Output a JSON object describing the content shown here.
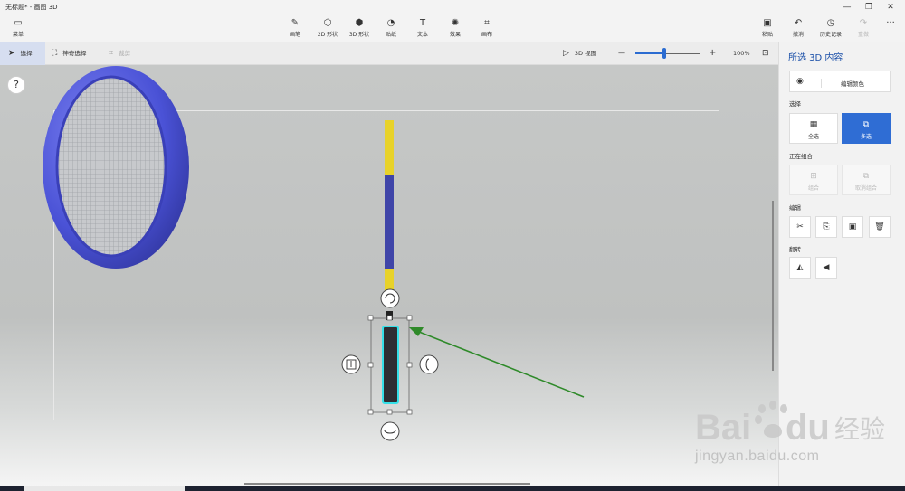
{
  "window": {
    "title": "无标题* - 画图 3D",
    "minimize": "—",
    "restore": "❐",
    "close": "✕"
  },
  "topbar": {
    "menu": {
      "label": "菜单",
      "icon": "folder-icon"
    },
    "tools": [
      {
        "label": "画笔",
        "icon": "brush-icon"
      },
      {
        "label": "2D 形状",
        "icon": "2d-shapes-icon"
      },
      {
        "label": "3D 形状",
        "icon": "3d-shapes-icon"
      },
      {
        "label": "贴纸",
        "icon": "sticker-icon"
      },
      {
        "label": "文本",
        "icon": "text-icon"
      },
      {
        "label": "效果",
        "icon": "effects-icon"
      },
      {
        "label": "画布",
        "icon": "canvas-icon"
      }
    ],
    "right": [
      {
        "label": "粘贴",
        "icon": "paste-icon"
      },
      {
        "label": "撤消",
        "icon": "undo-icon"
      },
      {
        "label": "历史记录",
        "icon": "history-icon"
      },
      {
        "label": "重做",
        "icon": "redo-icon"
      }
    ],
    "more": "···"
  },
  "toolbar": {
    "select": "选择",
    "magic_select": "神奇选择",
    "crop": "裁剪",
    "view3d": "3D 视图",
    "zoom_minus": "—",
    "zoom_plus": "+",
    "zoom_level": "100%",
    "zoom_fraction": 0.45
  },
  "canvas": {
    "help": "?"
  },
  "panel": {
    "title": "所选 3D 内容",
    "edit_color": "编辑颜色",
    "select_heading": "选择",
    "select_all": "全选",
    "multi_select": "多选",
    "group_heading": "正在组合",
    "group": "组合",
    "ungroup": "取消组合",
    "edit_heading": "编辑",
    "flip_heading": "翻转"
  },
  "watermark": {
    "brand": "Bai",
    "brand2": "du",
    "cn": "经验",
    "url": "jingyan.baidu.com"
  },
  "colors": {
    "accent": "#2f6dd4",
    "ring": "#4a55d8",
    "shaft_yellow": "#e8d22a",
    "shaft_blue": "#3f45a8",
    "handle": "#2e2e33",
    "highlight": "#35e0e8",
    "arrow": "#2f8a2a"
  }
}
